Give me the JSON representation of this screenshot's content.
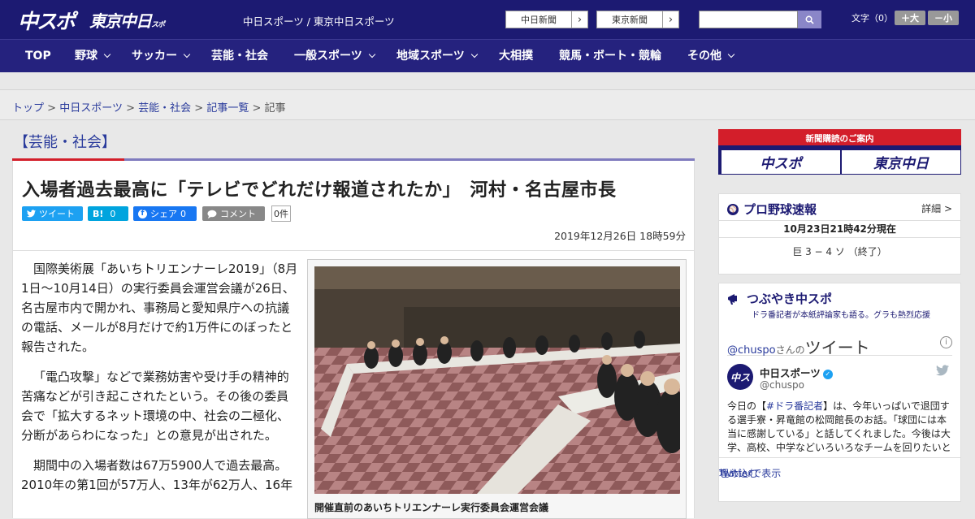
{
  "header": {
    "logo_chunichi_sports": "中スポ",
    "logo_tokyo_chunichi": "東京中日",
    "logo_tokyo_small": "スポーツ",
    "site_links": "中日スポーツ / 東京中日スポーツ",
    "btn_chunichi_shimbun": "中日新聞",
    "btn_tokyo_shimbun": "東京新聞",
    "font_size_label": "文字（0）",
    "font_bigger": "＋大",
    "font_smaller": "－小",
    "search_placeholder": ""
  },
  "nav": {
    "items": [
      {
        "label": "TOP"
      },
      {
        "label": "野球"
      },
      {
        "label": "サッカー"
      },
      {
        "label": "芸能・社会"
      },
      {
        "label": "一般スポーツ"
      },
      {
        "label": "地域スポーツ"
      },
      {
        "label": "大相撲"
      },
      {
        "label": "競馬・ボート・競輪"
      },
      {
        "label": "その他"
      }
    ]
  },
  "breadcrumb": {
    "items": [
      "トップ",
      "中日スポーツ",
      "芸能・社会",
      "記事一覧"
    ],
    "current": "記事",
    "separator": ">"
  },
  "section": {
    "title": "【芸能・社会】"
  },
  "article": {
    "headline": "入場者過去最高に「テレビでどれだけ報道されたか」　河村・名古屋市長",
    "share": {
      "tweet": "ツイート",
      "hatena_label": "B!",
      "hatena_count": "0",
      "facebook": "シェア",
      "facebook_count": "0",
      "comment": "コメント",
      "comment_count": "0件"
    },
    "date": "2019年12月26日 18時59分",
    "paragraphs": [
      "国際美術展「あいちトリエンナーレ2019」（8月1日～10月14日）の実行委員会運営会議が26日、名古屋市内で開かれ、事務局と愛知県庁への抗議の電話、メールが8月だけで約1万件にのぼったと報告された。",
      "「電凸攻撃」などで業務妨害や受け手の精神的苦痛などが引き起こされたという。その後の委員会で「拡大するネット環境の中、社会の二極化、分断があらわになった」との意見が出された。",
      "期間中の入場者数は67万5900人で過去最高。2010年の第1回が57万人、13年が62万人、16年"
    ],
    "photo_caption": "開催直前のあいちトリエンナーレ実行委員会運営会議"
  },
  "sidebar": {
    "banner_title": "新聞購読のご案内",
    "banner_logo1": "中スポ",
    "banner_logo2": "東京中日",
    "baseball": {
      "title": "プロ野球速報",
      "detail": "詳細 >",
      "updated": "10月23日21時42分現在",
      "score": "巨 3 − 4 ソ （終了）"
    },
    "tweets": {
      "title": "つぶやき中スポ",
      "subtitle": "ドラ番記者が本紙評論家も語る。グラも熱烈応援",
      "handle": "@chuspo",
      "handle_suffix": "さんの",
      "tweet_word": "ツイート",
      "user_name": "中日スポーツ",
      "user_handle": "@chuspo",
      "text_pre": "今日の【",
      "text_tag": "#ドラ番記者",
      "text_post": "】は、今年いっぱいで退団する選手寮・昇竜館の松岡館長のお話。「球団には本当に感謝している」と話してくれました。今後は大学、高校、中学などいろいろなチームを回りたいと",
      "embed": "埋め込む",
      "view_on_twitter": "Twitterで表示"
    }
  },
  "colors": {
    "brand_navy": "#1c1a72",
    "accent_red": "#d31e2a",
    "link_blue": "#2a3b9c",
    "twitter": "#1da1f2",
    "facebook": "#1877f2",
    "hatena": "#00a4de"
  }
}
